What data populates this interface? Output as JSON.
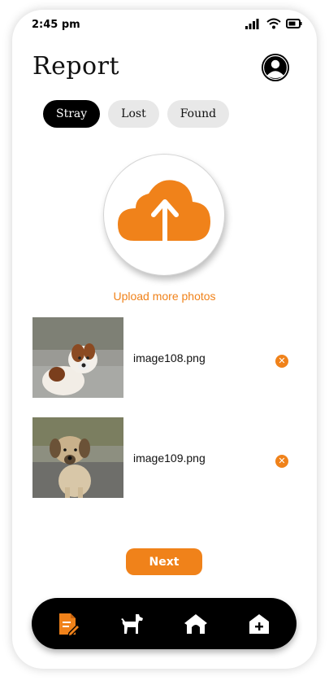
{
  "status_bar": {
    "time": "2:45 pm"
  },
  "header": {
    "title": "Report",
    "avatar_icon": "user-icon"
  },
  "tabs": [
    {
      "label": "Stray",
      "active": true
    },
    {
      "label": "Lost",
      "active": false
    },
    {
      "label": "Found",
      "active": false
    }
  ],
  "upload": {
    "icon": "cloud-upload-icon",
    "link_label": "Upload more photos"
  },
  "files": [
    {
      "name": "image108.png"
    },
    {
      "name": "image109.png"
    }
  ],
  "actions": {
    "next_label": "Next"
  },
  "bottom_nav": [
    {
      "icon": "report-document-icon",
      "active": true
    },
    {
      "icon": "dog-icon",
      "active": false
    },
    {
      "icon": "shelter-icon",
      "active": false
    },
    {
      "icon": "add-home-icon",
      "active": false
    }
  ],
  "colors": {
    "accent": "#f0821a",
    "dark": "#000000",
    "tab_inactive": "#e8e8e8"
  }
}
